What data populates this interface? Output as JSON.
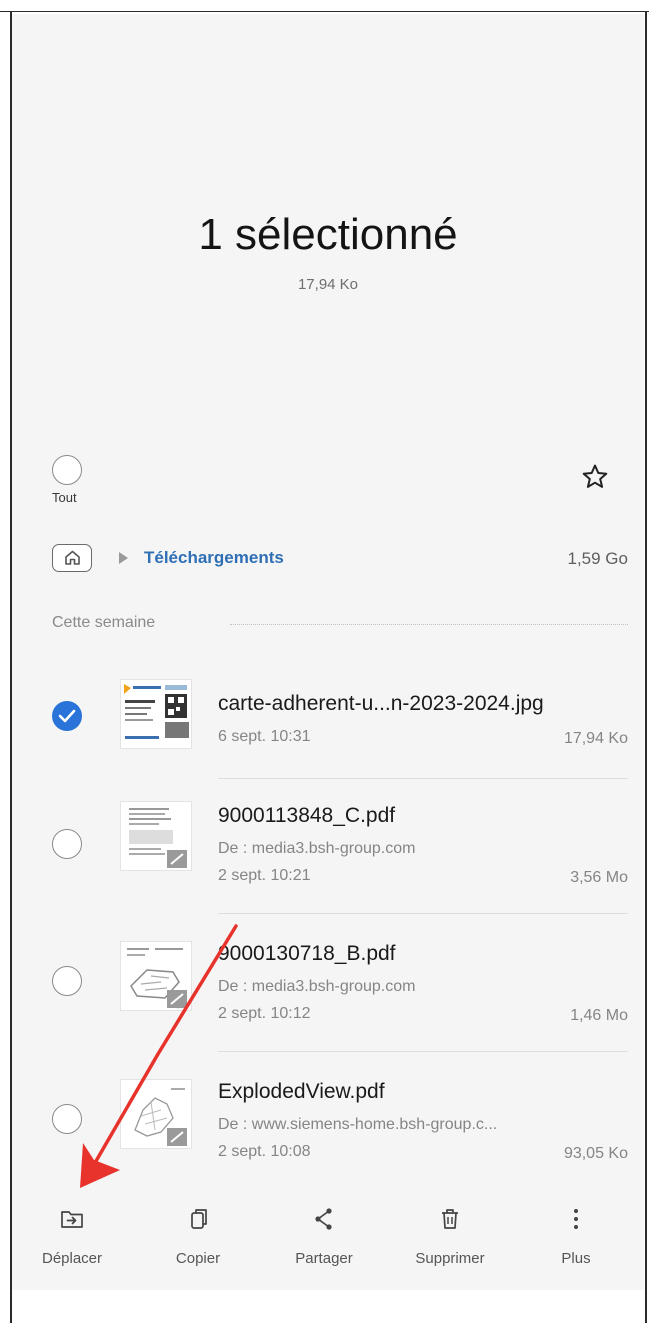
{
  "header": {
    "title": "1 sélectionné",
    "subtitle": "17,94 Ko"
  },
  "select_all": {
    "label": "Tout",
    "checked": false
  },
  "favorite_icon": "star-outline-icon",
  "path": {
    "home_icon": "home-icon",
    "folder": "Téléchargements",
    "size": "1,59 Go"
  },
  "section": {
    "label": "Cette semaine"
  },
  "files": [
    {
      "name": "carte-adherent-u...n-2023-2024.jpg",
      "date": "6 sept. 10:31",
      "size": "17,94 Ko",
      "selected": true
    },
    {
      "name": "9000113848_C.pdf",
      "source": "De : media3.bsh-group.com",
      "date": "2 sept. 10:21",
      "size": "3,56 Mo",
      "selected": false
    },
    {
      "name": "9000130718_B.pdf",
      "source": "De : media3.bsh-group.com",
      "date": "2 sept. 10:12",
      "size": "1,46 Mo",
      "selected": false
    },
    {
      "name": "ExplodedView.pdf",
      "source": "De : www.siemens-home.bsh-group.c...",
      "date": "2 sept. 10:08",
      "size": "93,05 Ko",
      "selected": false
    }
  ],
  "toolbar": {
    "move": {
      "label": "Déplacer",
      "icon": "move-to-folder-icon"
    },
    "copy": {
      "label": "Copier",
      "icon": "copy-icon"
    },
    "share": {
      "label": "Partager",
      "icon": "share-icon"
    },
    "delete": {
      "label": "Supprimer",
      "icon": "trash-icon"
    },
    "more": {
      "label": "Plus",
      "icon": "more-vertical-icon"
    }
  },
  "annotation": {
    "color": "#e8322c"
  }
}
